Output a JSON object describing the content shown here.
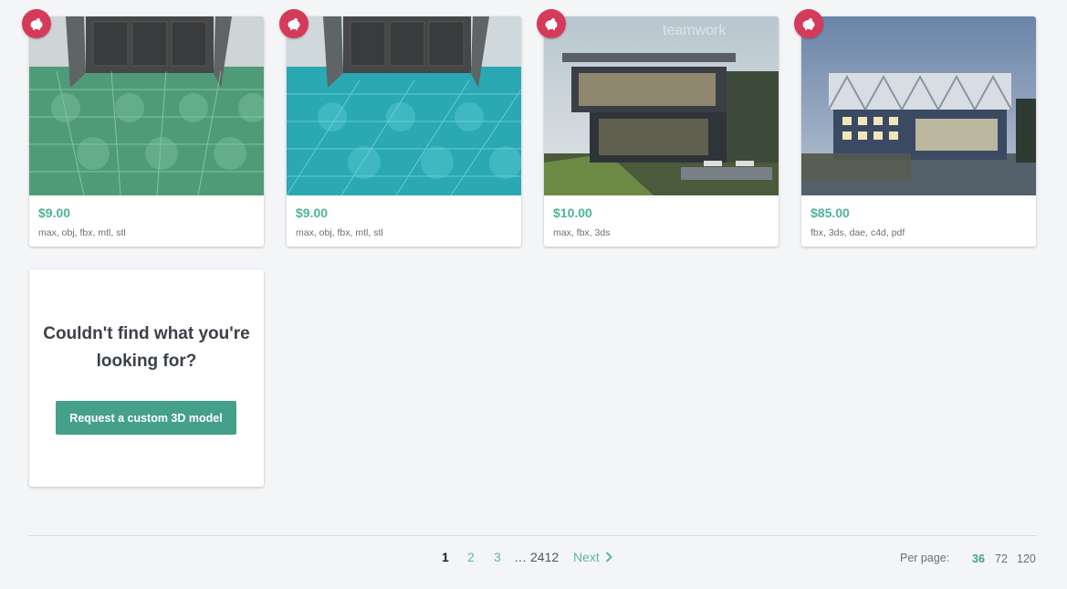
{
  "products": [
    {
      "price": "$9.00",
      "formats": "max, obj, fbx, mtl, stl",
      "icon": "piggy-bank-icon"
    },
    {
      "price": "$9.00",
      "formats": "max, obj, fbx, mtl, stl",
      "icon": "piggy-bank-icon"
    },
    {
      "price": "$10.00",
      "formats": "max, fbx, 3ds",
      "icon": "piggy-bank-icon"
    },
    {
      "price": "$85.00",
      "formats": "fbx, 3ds, dae, c4d, pdf",
      "icon": "piggy-bank-icon"
    }
  ],
  "request": {
    "title": "Couldn't find what you're looking for?",
    "button_label": "Request a custom 3D model"
  },
  "pagination": {
    "current": "1",
    "pages": [
      "2",
      "3"
    ],
    "ellipsis": "…",
    "last": "2412",
    "next_label": "Next"
  },
  "per_page": {
    "label": "Per page:",
    "options": [
      "36",
      "72",
      "120"
    ],
    "selected": "36"
  },
  "colors": {
    "accent": "#45a08a",
    "price": "#4fb39a",
    "badge": "#d63a5a"
  }
}
